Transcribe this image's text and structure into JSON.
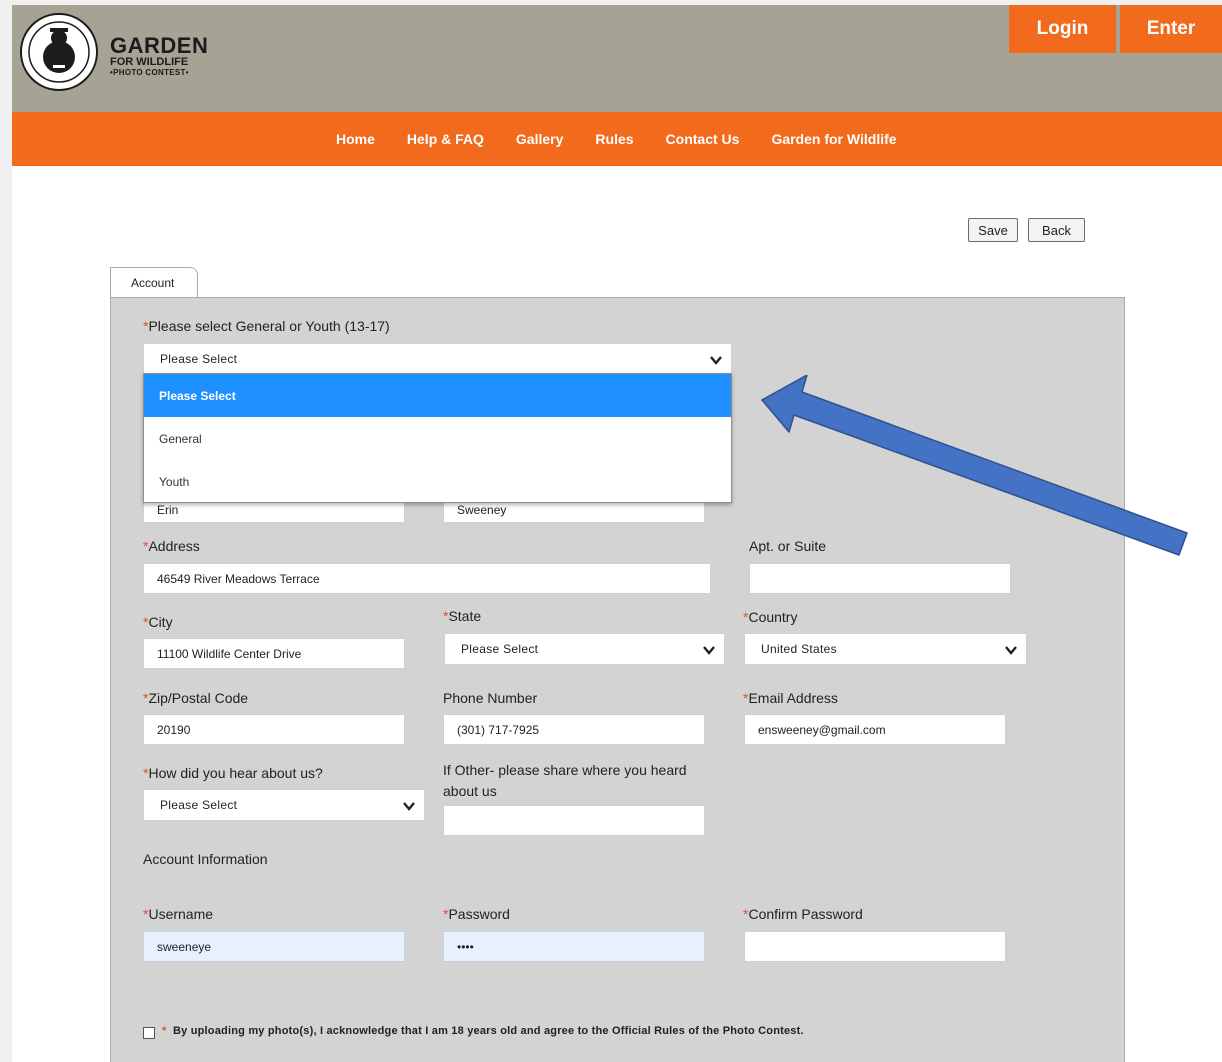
{
  "header": {
    "brand_line1": "GARDEN",
    "brand_line2": "FOR WILDLIFE",
    "brand_line3": "•PHOTO CONTEST•",
    "login_label": "Login",
    "enter_label": "Enter"
  },
  "nav": {
    "items": [
      "Home",
      "Help & FAQ",
      "Gallery",
      "Rules",
      "Contact Us",
      "Garden for Wildlife"
    ]
  },
  "actions": {
    "save_label": "Save",
    "back_label": "Back"
  },
  "tab": {
    "label": "Account"
  },
  "form": {
    "category": {
      "label": "Please select General or Youth (13-17)",
      "value": "Please Select",
      "options": [
        "Please Select",
        "General",
        "Youth"
      ]
    },
    "first_name": {
      "value": "Erin"
    },
    "last_name": {
      "value": "Sweeney"
    },
    "address": {
      "label": "Address",
      "value": "46549 River Meadows Terrace"
    },
    "apt": {
      "label": "Apt. or Suite",
      "value": ""
    },
    "city": {
      "label": "City",
      "value": "11100 Wildlife Center Drive"
    },
    "state": {
      "label": "State",
      "value": "Please Select"
    },
    "country": {
      "label": "Country",
      "value": "United States"
    },
    "zip": {
      "label": "Zip/Postal Code",
      "value": "20190"
    },
    "phone": {
      "label": "Phone Number",
      "value": "(301) 717-7925"
    },
    "email": {
      "label": "Email Address",
      "value": "ensweeney@gmail.com"
    },
    "hear": {
      "label": "How did you hear about us?",
      "value": "Please Select"
    },
    "other": {
      "label_line1": "If Other- please share where you heard",
      "label_line2": "about us",
      "value": ""
    },
    "account_info_label": "Account Information",
    "username": {
      "label": "Username",
      "value": "sweeneye"
    },
    "password": {
      "label": "Password",
      "value": "••••"
    },
    "confirm_password": {
      "label": "Confirm Password",
      "value": ""
    },
    "required_mark": "*",
    "agree_text": "By uploading my photo(s), I acknowledge that I am 18 years old and agree to the Official Rules of the Photo Contest."
  },
  "colors": {
    "orange": "#f26a1b",
    "header_bg": "#a7a394",
    "panel_bg": "#d3d3d3",
    "selected_option": "#1e90ff",
    "arrow": "#4472c4"
  }
}
